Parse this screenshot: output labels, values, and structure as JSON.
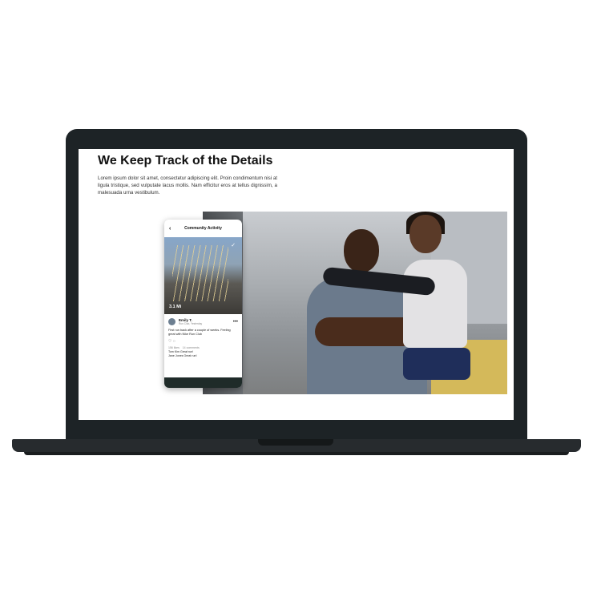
{
  "page": {
    "title": "We Keep Track of the Details",
    "body": "Lorem ipsum dolor sit amet, consectetur adipiscing elit. Proin condimentum nisi at ligula tristique, sed vulputate lacus mollis. Nam efficitur eros at tellus dignissim, a malesuada urna vestibulum."
  },
  "phone": {
    "back_icon": "chevron-left-icon",
    "title": "Community Activity",
    "brand_icon": "swoosh-icon",
    "stat": "3.1 Mi",
    "post": {
      "name": "Emily T.",
      "subtitle": "Run Club, Yesterday",
      "text": "First run back after a couple of weeks. Feeling great with Nike Run Club",
      "likes": "156 likes",
      "comments_count": "14 comments",
      "comments": [
        "Tom Kim Great run!",
        "Jane Jones Great run!"
      ]
    }
  },
  "colors": {
    "frame": "#1d2326",
    "base": "#272b2e",
    "phone_footer": "#1f2b29"
  }
}
